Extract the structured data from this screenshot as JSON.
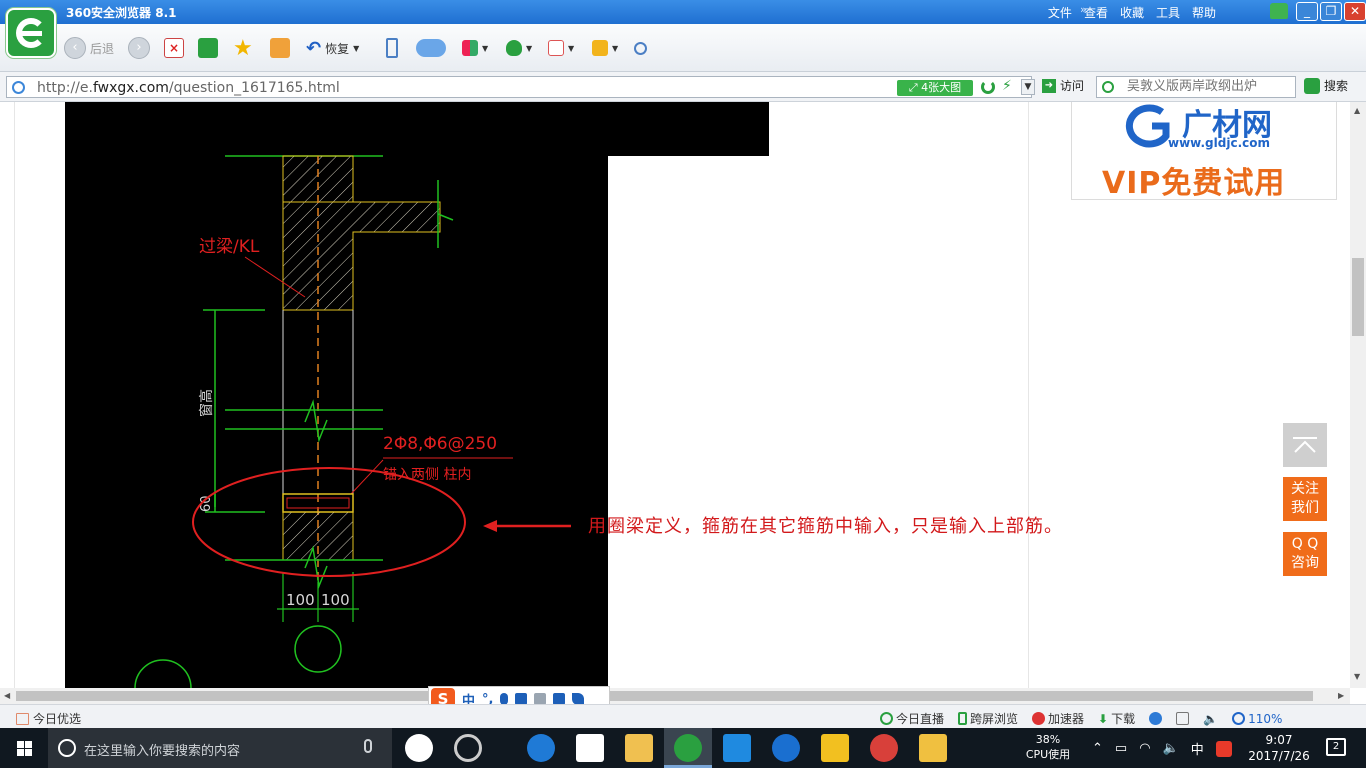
{
  "window": {
    "title": "360安全浏览器 8.1",
    "menu": [
      "文件",
      "查看",
      "收藏",
      "工具",
      "帮助"
    ],
    "controls": {
      "minimize": "_",
      "maximize": "❐",
      "close": "✕"
    }
  },
  "toolbar": {
    "back_label": "后退",
    "restore_label": "恢复"
  },
  "address_bar": {
    "url_prefix": "http://e.",
    "url_domain": "fwxgx.com",
    "url_path": "/question_1617165.html",
    "big_picture_label": "4张大图",
    "visit_label": "访问",
    "search_placeholder": "吴敦义版两岸政纲出炉",
    "search_label": "搜索"
  },
  "drawing": {
    "beam_label": "过梁/KL",
    "window_height_label": "窗高",
    "rebar_label": "2Φ8,Φ6@250",
    "rebar_note": "锚入两侧    柱内",
    "dim_60": "60",
    "dim_left": "100",
    "dim_right": "100"
  },
  "annotation": {
    "text": "用圈梁定义，箍筋在其它箍筋中输入，只是输入上部筋。"
  },
  "ad": {
    "brand": "广材网",
    "url": "www.gldjc.com",
    "slogan": "VIP免费试用"
  },
  "side_buttons": {
    "follow_line1": "关注",
    "follow_line2": "我们",
    "qq_line1": "Q Q",
    "qq_line2": "咨询"
  },
  "ime": {
    "logo": "S",
    "items": [
      "中",
      "°,"
    ]
  },
  "statusbar": {
    "left_label": "今日优选",
    "items": [
      "今日直播",
      "跨屏浏览",
      "加速器",
      "下载"
    ],
    "zoom": "110%"
  },
  "taskbar": {
    "search_placeholder": "在这里输入你要搜索的内容",
    "cpu_percent": "38%",
    "cpu_label": "CPU使用",
    "ime_indicator": "中",
    "time": "9:07",
    "date": "2017/7/26",
    "notifications": "2"
  }
}
